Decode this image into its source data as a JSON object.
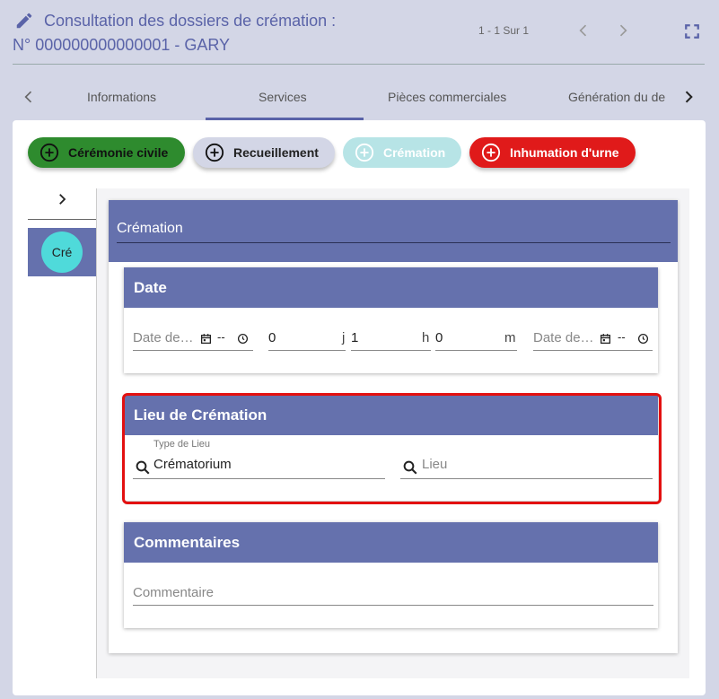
{
  "header": {
    "title_line1": "Consultation des dossiers de crémation :",
    "title_line2": "N° 000000000000001 - GARY",
    "pager": "1 - 1 Sur 1"
  },
  "tabs": [
    {
      "label": "Informations"
    },
    {
      "label": "Services"
    },
    {
      "label": "Pièces commerciales"
    },
    {
      "label": "Génération du de"
    }
  ],
  "chips": {
    "civile": "Cérémonie civile",
    "recueillement": "Recueillement",
    "cremation": "Crémation",
    "inhumation": "Inhumation d'urne"
  },
  "sidebar": {
    "avatar": "Cré"
  },
  "card": {
    "title": "Crémation"
  },
  "date_section": {
    "title": "Date",
    "date_start_placeholder": "Date de…",
    "time_start": "--",
    "days_value": "0",
    "days_suffix": "j",
    "hours_value": "1",
    "hours_suffix": "h",
    "minutes_value": "0",
    "minutes_suffix": "m",
    "date_end_placeholder": "Date de…",
    "time_end": "--"
  },
  "lieu_section": {
    "title": "Lieu de Crémation",
    "type_label": "Type de Lieu",
    "type_value": "Crématorium",
    "lieu_placeholder": "Lieu"
  },
  "comment_section": {
    "title": "Commentaires",
    "placeholder": "Commentaire"
  },
  "colors": {
    "accent": "#6571ad",
    "civile": "#2e8b2e",
    "inhumation": "#e01a1a",
    "cremation_chip": "#b7e4e6",
    "highlight": "#e31010"
  }
}
